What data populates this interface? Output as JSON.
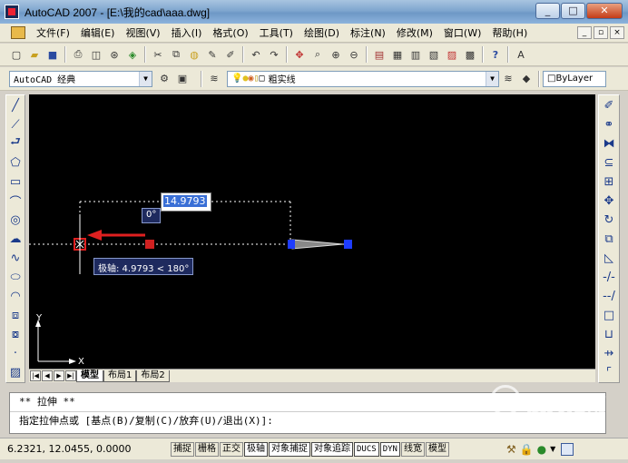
{
  "window": {
    "title": "AutoCAD 2007 - [E:\\我的cad\\aaa.dwg]",
    "minimize": "_",
    "maximize": "□",
    "close": "✕"
  },
  "menu": {
    "items": [
      "文件(F)",
      "编辑(E)",
      "视图(V)",
      "插入(I)",
      "格式(O)",
      "工具(T)",
      "绘图(D)",
      "标注(N)",
      "修改(M)",
      "窗口(W)",
      "帮助(H)"
    ],
    "mdi": [
      "_",
      "▫",
      "×"
    ]
  },
  "toolbar2": {
    "workspace": "AutoCAD 经典",
    "layer": "粗实线",
    "bylayer": "ByLayer"
  },
  "drawing": {
    "dimension_input": "14.9793",
    "angle_tooltip": "0°",
    "polar_tooltip": "极轴: 4.9793 < 180°",
    "ucs_y": "Y",
    "ucs_x": "X"
  },
  "layout_tabs": [
    "模型",
    "布局1",
    "布局2"
  ],
  "command": {
    "line1": "** 拉伸 **",
    "line2": "指定拉伸点或 [基点(B)/复制(C)/放弃(U)/退出(X)]:"
  },
  "status": {
    "coords": "6.2321,  12.0455, 0.0000",
    "buttons": [
      "捕捉",
      "栅格",
      "正交",
      "极轴",
      "对象捕捉",
      "对象追踪",
      "DUCS",
      "DYN",
      "线宽",
      "模型"
    ]
  },
  "watermark": {
    "text": "搜狗指南",
    "url": "zhinan.sogou.com"
  },
  "colors": {
    "canvas_bg": "#000000",
    "grip_selected": "#e02020",
    "grip_blue": "#1e3cff",
    "tooltip_bg": "#1e2a5e",
    "input_bg": "#3a6fd6"
  }
}
